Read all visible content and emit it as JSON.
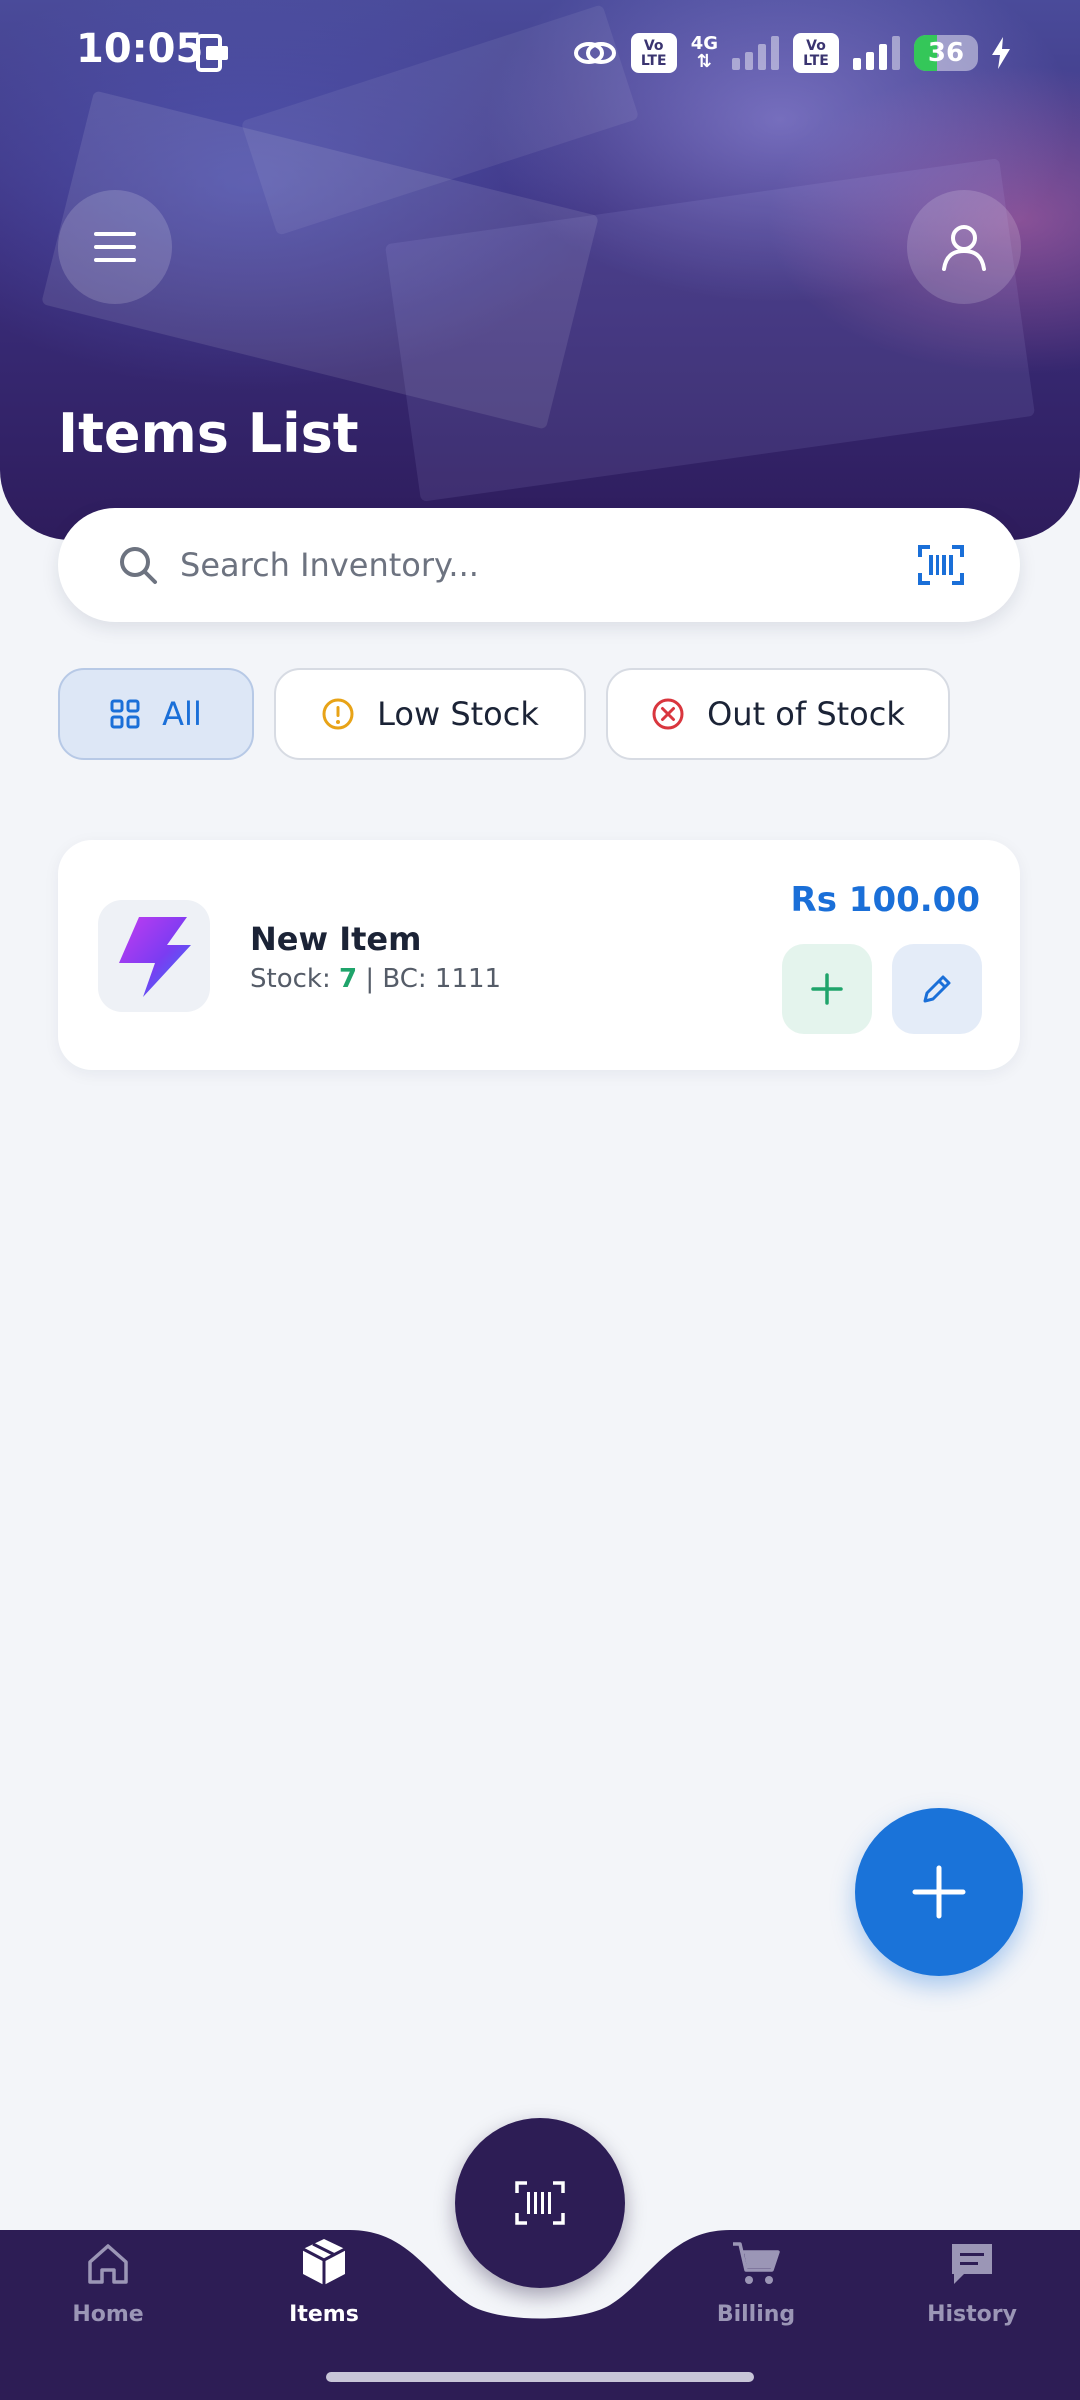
{
  "status_bar": {
    "time": "10:05",
    "network": "4G",
    "volte": "Vo\nLTE",
    "battery": "36",
    "battery_level": 0.36
  },
  "header": {
    "title": "Items List"
  },
  "search": {
    "placeholder": "Search Inventory..."
  },
  "filters": [
    {
      "label": "All",
      "active": true
    },
    {
      "label": "Low Stock",
      "active": false
    },
    {
      "label": "Out of Stock",
      "active": false
    }
  ],
  "items": [
    {
      "name": "New Item",
      "stock_label": "Stock: ",
      "stock": "7",
      "barcode_label": " | BC: 1111",
      "price": "Rs 100.00"
    }
  ],
  "nav": {
    "home": "Home",
    "items": "Items",
    "billing": "Billing",
    "history": "History"
  },
  "colors": {
    "accent": "#1a73d9",
    "nav_bg": "#2d1d55",
    "stock_ok": "#1fa46b",
    "warning": "#e8a317",
    "danger": "#d9363e"
  },
  "icons": {
    "menu": "hamburger-icon",
    "profile": "user-icon",
    "search": "search-icon",
    "barcode": "barcode-scan-icon",
    "all": "grid-icon",
    "low_stock": "alert-circle-icon",
    "out_of_stock": "x-circle-icon",
    "item_thumb": "lightning-icon",
    "add_stock": "plus-icon",
    "edit": "pencil-icon",
    "fab": "plus-icon"
  }
}
